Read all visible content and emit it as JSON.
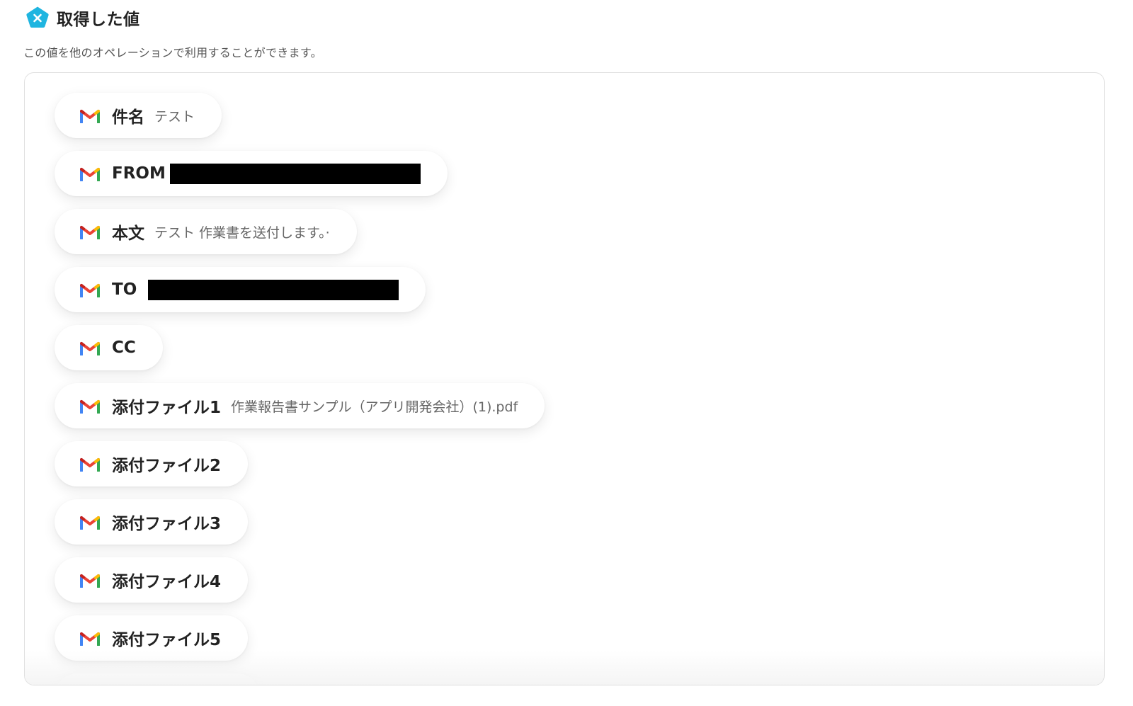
{
  "header": {
    "icon": "yoom-pentagon-icon",
    "accent_color": "#1fb5e0",
    "title": "取得した値"
  },
  "subtitle": "この値を他のオペレーションで利用することができます。",
  "fields": [
    {
      "icon": "gmail-icon",
      "label": "件名",
      "value": "テスト"
    },
    {
      "icon": "gmail-icon",
      "label": "FROM",
      "value": "",
      "redacted": true
    },
    {
      "icon": "gmail-icon",
      "label": "本文",
      "value": "テスト 作業書を送付します。·"
    },
    {
      "icon": "gmail-icon",
      "label": "TO",
      "value": "",
      "redacted": true
    },
    {
      "icon": "gmail-icon",
      "label": "CC",
      "value": ""
    },
    {
      "icon": "gmail-icon",
      "label": "添付ファイル1",
      "value": "作業報告書サンプル（アプリ開発会社）(1).pdf"
    },
    {
      "icon": "gmail-icon",
      "label": "添付ファイル2",
      "value": ""
    },
    {
      "icon": "gmail-icon",
      "label": "添付ファイル3",
      "value": ""
    },
    {
      "icon": "gmail-icon",
      "label": "添付ファイル4",
      "value": ""
    },
    {
      "icon": "gmail-icon",
      "label": "添付ファイル5",
      "value": ""
    }
  ]
}
